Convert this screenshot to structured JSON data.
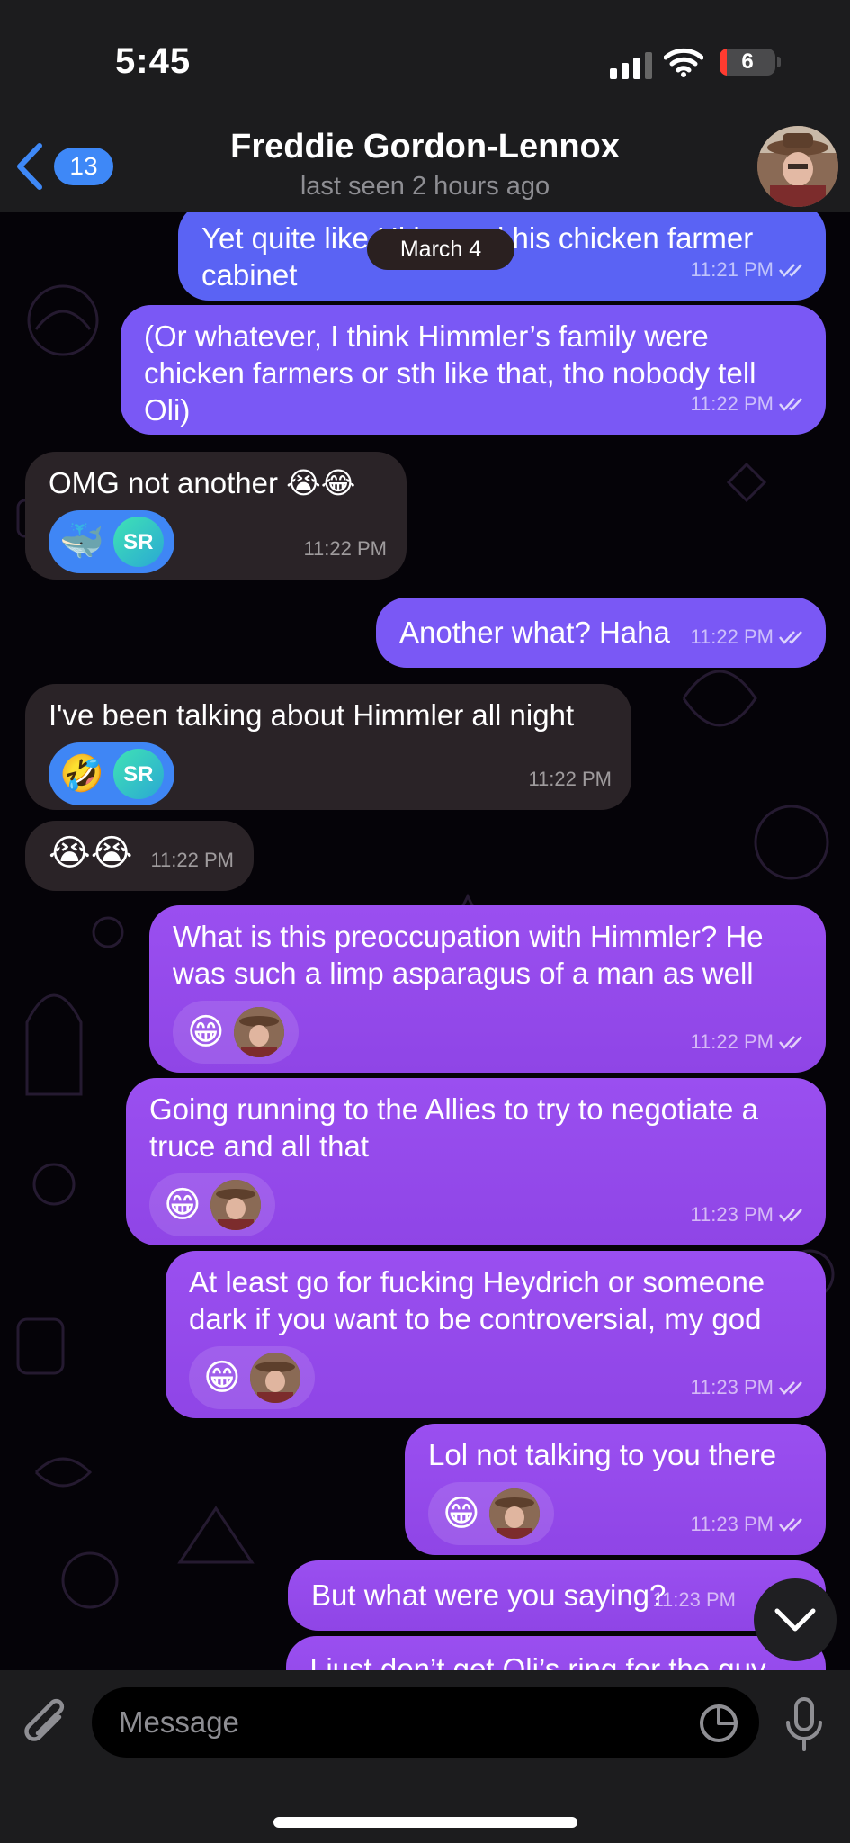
{
  "status_bar": {
    "time": "5:45",
    "battery_level": "6"
  },
  "header": {
    "back_count": "13",
    "contact_name": "Freddie Gordon-Lennox",
    "last_seen": "last seen 2 hours ago"
  },
  "date_pill": "March 4",
  "messages": [
    {
      "direction": "out",
      "text": "Yet quite like Hitler and his chicken farmer cabinet",
      "time": "11:21 PM"
    },
    {
      "direction": "out",
      "text": "(Or whatever, I think Himmler’s family were chicken farmers or sth like that, tho nobody tell Oli)",
      "time": "11:22 PM"
    },
    {
      "direction": "in",
      "text": "OMG not another 😭😂",
      "time": "11:22 PM",
      "reactions": [
        "🐳",
        "SR"
      ]
    },
    {
      "direction": "out",
      "text": "Another what? Haha",
      "time": "11:22 PM"
    },
    {
      "direction": "in",
      "text": "I've been talking about Himmler all night",
      "time": "11:22 PM",
      "reactions": [
        "🤣",
        "SR"
      ]
    },
    {
      "direction": "in",
      "text": "😭😭",
      "time": "11:22 PM"
    },
    {
      "direction": "out",
      "text": "What is this preoccupation with Himmler? He was such a limp asparagus of a man as well",
      "time": "11:22 PM",
      "reactions": [
        "😁"
      ]
    },
    {
      "direction": "out",
      "text": "Going running to the Allies to try to negotiate a truce and all that",
      "time": "11:23 PM",
      "reactions": [
        "😁"
      ]
    },
    {
      "direction": "out",
      "text": "At least go for fucking Heydrich or someone dark if you want to be controversial, my god",
      "time": "11:23 PM",
      "reactions": [
        "😁"
      ]
    },
    {
      "direction": "out",
      "text": "Lol not talking to you there",
      "time": "11:23 PM",
      "reactions": [
        "😁"
      ]
    },
    {
      "direction": "out",
      "text": "But what were you saying?",
      "time": "11:23 PM"
    },
    {
      "direction": "out",
      "text": "I just don’t get Oli’s ring for the guy",
      "time": ""
    }
  ],
  "input": {
    "placeholder": "Message"
  },
  "icons": {
    "back": "chevron-left-icon",
    "attach": "paperclip-icon",
    "sticker": "sticker-icon",
    "mic": "microphone-icon",
    "scroll": "chevron-down-icon",
    "read": "double-check-icon"
  },
  "colors": {
    "accent": "#3e88f7",
    "outgoing_bubble": "#9a4ff0",
    "outgoing_bubble_top": "#5a63f4",
    "incoming_bubble": "#2a2327",
    "header_bg": "#1c1c1e"
  }
}
